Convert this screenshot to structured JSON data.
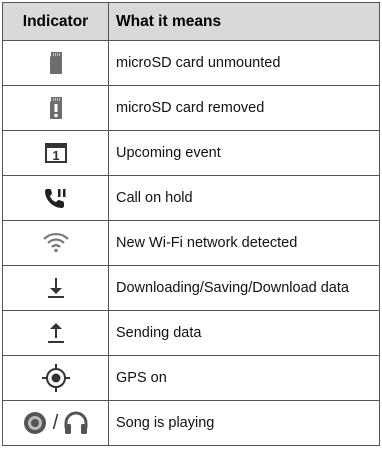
{
  "table": {
    "headers": {
      "indicator": "Indicator",
      "meaning": "What it means"
    },
    "rows": [
      {
        "icon": "microsd-unmounted-icon",
        "text": "microSD card unmounted"
      },
      {
        "icon": "microsd-removed-icon",
        "text": "microSD card removed"
      },
      {
        "icon": "calendar-event-icon",
        "text": "Upcoming event"
      },
      {
        "icon": "call-hold-icon",
        "text": "Call on hold"
      },
      {
        "icon": "wifi-new-network-icon",
        "text": "New Wi-Fi network detected"
      },
      {
        "icon": "download-arrow-icon",
        "text": "Downloading/Saving/Download data"
      },
      {
        "icon": "upload-arrow-icon",
        "text": "Sending data"
      },
      {
        "icon": "gps-icon",
        "text": "GPS on"
      },
      {
        "icon": "music-disc-headphones-icon",
        "text": "Song is playing"
      }
    ],
    "song_row_separator": "/",
    "calendar_day": "1"
  }
}
